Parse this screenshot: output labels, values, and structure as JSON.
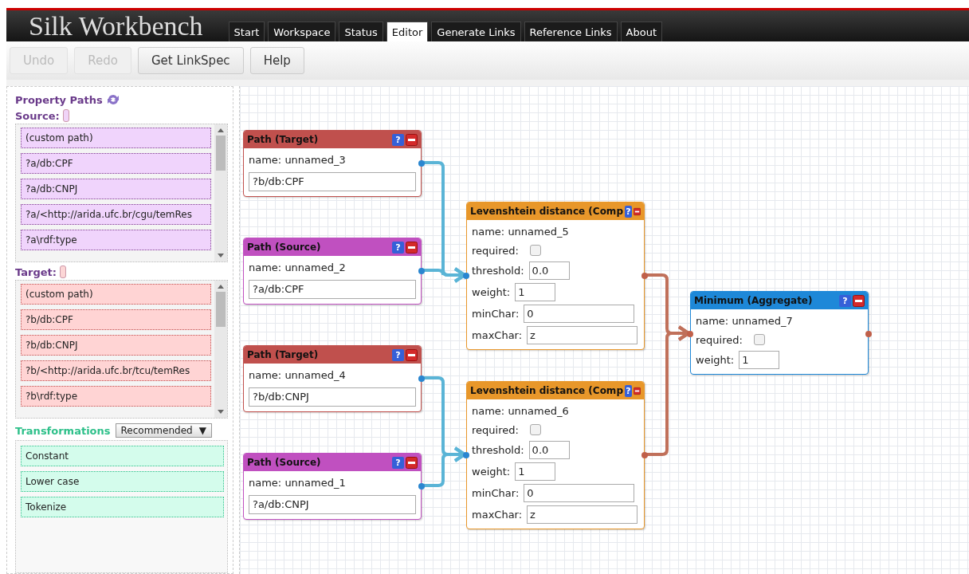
{
  "header": {
    "title": "Silk Workbench",
    "tabs": [
      {
        "label": "Start",
        "selected": false
      },
      {
        "label": "Workspace",
        "selected": false
      },
      {
        "label": "Status",
        "selected": false
      },
      {
        "label": "Editor",
        "selected": true
      },
      {
        "label": "Generate Links",
        "selected": false
      },
      {
        "label": "Reference Links",
        "selected": false
      },
      {
        "label": "About",
        "selected": false
      }
    ]
  },
  "toolbar": [
    {
      "label": "Undo",
      "disabled": true
    },
    {
      "label": "Redo",
      "disabled": true
    },
    {
      "label": "Get LinkSpec",
      "disabled": false
    },
    {
      "label": "Help",
      "disabled": false
    }
  ],
  "sidebar": {
    "title": "Property Paths",
    "lists": [
      {
        "kind": "source",
        "label": "Source:",
        "items": [
          "(custom path)",
          "?a/db:CPF",
          "?a/db:CNPJ",
          "?a/<http://arida.ufc.br/cgu/temRes",
          "?a\\rdf:type"
        ]
      },
      {
        "kind": "target",
        "label": "Target:",
        "items": [
          "(custom path)",
          "?b/db:CPF",
          "?b/db:CNPJ",
          "?b/<http://arida.ufc.br/tcu/temRes",
          "?b\\rdf:type"
        ]
      }
    ],
    "transformations": {
      "label": "Transformations",
      "filter": "Recommended",
      "caret": "▼",
      "items": [
        "Constant",
        "Lower case",
        "Tokenize"
      ]
    }
  },
  "canvas": {
    "nodes": [
      {
        "kind": "target",
        "title": "Path (Target)",
        "help": "?",
        "fields": [
          {
            "kind": "text",
            "label": "name: unnamed_3"
          },
          {
            "kind": "path",
            "value": "?b/db:CPF"
          }
        ]
      },
      {
        "kind": "source",
        "title": "Path (Source)",
        "help": "?",
        "fields": [
          {
            "kind": "text",
            "label": "name: unnamed_2"
          },
          {
            "kind": "path",
            "value": "?a/db:CPF"
          }
        ]
      },
      {
        "kind": "target",
        "title": "Path (Target)",
        "help": "?",
        "fields": [
          {
            "kind": "text",
            "label": "name: unnamed_4"
          },
          {
            "kind": "path",
            "value": "?b/db:CNPJ"
          }
        ]
      },
      {
        "kind": "source",
        "title": "Path (Source)",
        "help": "?",
        "fields": [
          {
            "kind": "text",
            "label": "name: unnamed_1"
          },
          {
            "kind": "path",
            "value": "?a/db:CNPJ"
          }
        ]
      },
      {
        "kind": "comparison",
        "title": "Levenshtein distance (Comp",
        "help": "?",
        "fields": [
          {
            "kind": "text",
            "label": "name: unnamed_5"
          },
          {
            "kind": "checkbox",
            "label": "required:",
            "checked": false
          },
          {
            "kind": "short",
            "label": "threshold:",
            "value": "0.0"
          },
          {
            "kind": "short",
            "label": "weight:",
            "value": "1"
          },
          {
            "kind": "long",
            "label": "minChar:",
            "value": "0"
          },
          {
            "kind": "long",
            "label": "maxChar:",
            "value": "z"
          }
        ]
      },
      {
        "kind": "comparison",
        "title": "Levenshtein distance (Comp",
        "help": "?",
        "fields": [
          {
            "kind": "text",
            "label": "name: unnamed_6"
          },
          {
            "kind": "checkbox",
            "label": "required:",
            "checked": false
          },
          {
            "kind": "short",
            "label": "threshold:",
            "value": "0.0"
          },
          {
            "kind": "short",
            "label": "weight:",
            "value": "1"
          },
          {
            "kind": "long",
            "label": "minChar:",
            "value": "0"
          },
          {
            "kind": "long",
            "label": "maxChar:",
            "value": "z"
          }
        ]
      },
      {
        "kind": "aggregate",
        "title": "Minimum (Aggregate)",
        "help": "?",
        "fields": [
          {
            "kind": "text",
            "label": "name: unnamed_7"
          },
          {
            "kind": "checkbox",
            "label": "required:",
            "checked": false
          },
          {
            "kind": "short",
            "label": "weight:",
            "value": "1"
          }
        ]
      }
    ]
  }
}
